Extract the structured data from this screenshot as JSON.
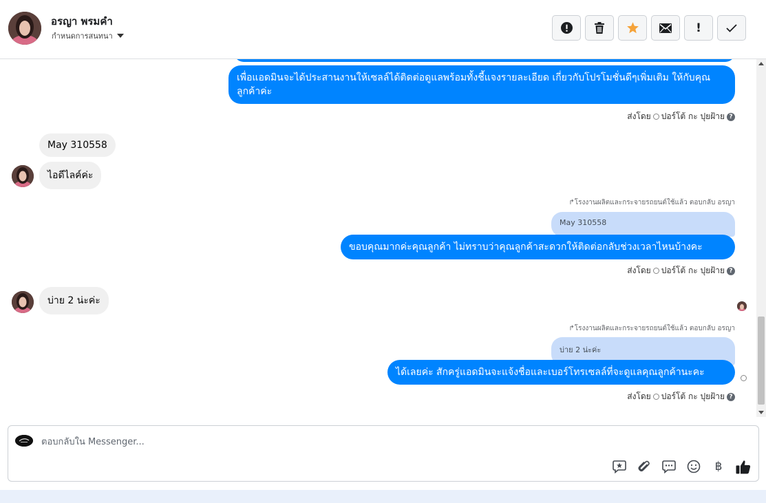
{
  "header": {
    "contact_name": "อรญา พรมคำ",
    "assign_label": "กำหนดการสนทนา",
    "actions": [
      {
        "name": "spam",
        "icon": "alert-circle-icon"
      },
      {
        "name": "delete",
        "icon": "trash-icon"
      },
      {
        "name": "star",
        "icon": "star-icon",
        "color": "#f5a33a"
      },
      {
        "name": "mark-unread",
        "icon": "envelope-icon"
      },
      {
        "name": "important",
        "label": "!"
      },
      {
        "name": "done",
        "icon": "check-icon"
      }
    ]
  },
  "messages": {
    "m1": {
      "text": "เพื่อแอดมินจะได้ประสานงานให้เซลล์ได้ติดต่อดูแลพร้อมทั้งชี้แจงรายละเอียด เกี่ยวกับโปรโมชั่นดีๆเพิ่มเติม ให้กับคุณลูกค้าค่ะ"
    },
    "m2": {
      "text": "May 310558"
    },
    "m3": {
      "text": "ไอดีไลค์ค่ะ"
    },
    "m4": {
      "reply_note": "โรงงานผลิตและกระจายรถยนต์ใช้แล้ว ตอบกลับ อรญา",
      "quote": "May 310558",
      "text": "ขอบคุณมากค่ะคุณลูกค้า ไม่ทราบว่าคุณลูกค้าสะดวกให้ติดต่อกลับช่วงเวลาไหนบ้างคะ"
    },
    "m5": {
      "text": "บ่าย 2 น่ะค่ะ"
    },
    "m6": {
      "reply_note": "โรงงานผลิตและกระจายรถยนต์ใช้แล้ว ตอบกลับ อรญา",
      "quote": "บ่าย 2 น่ะค่ะ",
      "text": "ได้เลยค่ะ สักครู่แอดมินจะแจ้งชื่อและเบอร์โทรเซลล์ที่จะดูแลคุณลูกค้านะคะ"
    }
  },
  "sent_by": {
    "prefix": "ส่งโดย",
    "agent": "ปอร์โต้ กะ ปุยฝ้าย"
  },
  "composer": {
    "placeholder": "ตอบกลับใน Messenger...",
    "value": "",
    "tools": [
      "saved-reply-icon",
      "attachment-icon",
      "chat-bubble-icon",
      "emoji-icon",
      "baht-icon",
      "like-icon"
    ],
    "baht_symbol": "฿"
  },
  "colors": {
    "outgoing": "#0084ff",
    "incoming": "#f0f0f0",
    "quote": "#c8dcfa",
    "like": "#1c1e21"
  }
}
